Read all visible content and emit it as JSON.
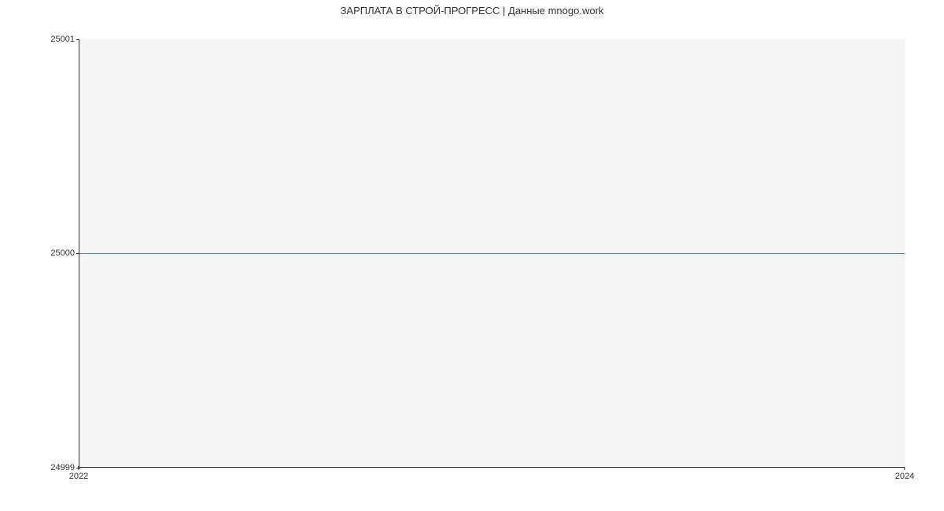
{
  "chart_data": {
    "type": "line",
    "title": "ЗАРПЛАТА В СТРОЙ-ПРОГРЕСС | Данные mnogo.work",
    "xlabel": "",
    "ylabel": "",
    "x": [
      2022,
      2024
    ],
    "values": [
      25000,
      25000
    ],
    "xlim": [
      2022,
      2024
    ],
    "ylim": [
      24999,
      25001
    ],
    "xticks": [
      2022,
      2024
    ],
    "yticks": [
      24999,
      25000,
      25001
    ],
    "line_color": "#4a7fe0",
    "plot_bg": "#f5f5f5"
  }
}
